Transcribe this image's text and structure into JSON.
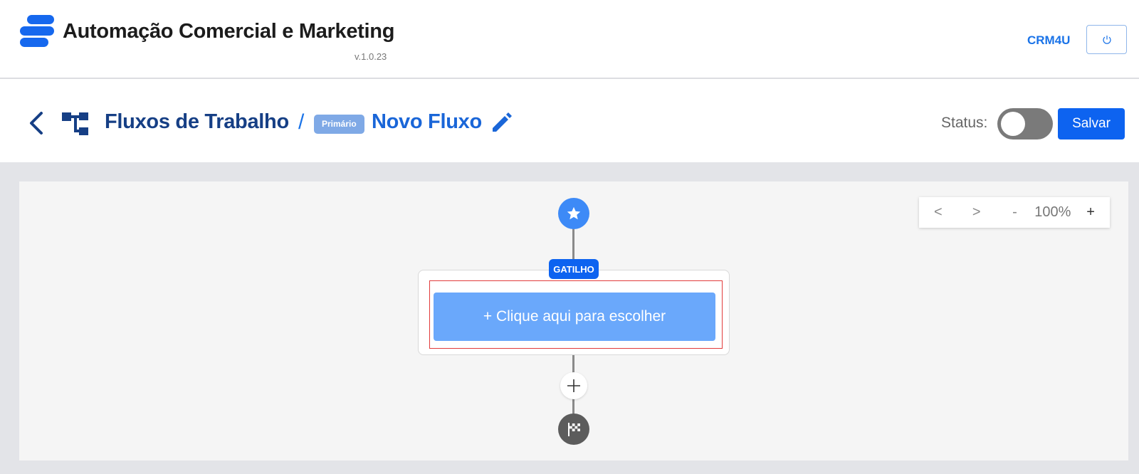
{
  "header": {
    "app_title": "Automação Comercial e Marketing",
    "version": "v.1.0.23",
    "brand_link": "CRM4U",
    "logo_icon": "stacked-bars-logo-icon",
    "power_icon": "power-icon",
    "accent_color": "#1a73e8"
  },
  "subheader": {
    "back_icon": "chevron-left-icon",
    "section_icon": "workflow-tree-icon",
    "section_title": "Fluxos de Trabalho",
    "separator": "/",
    "badge": "Primário",
    "flow_name": "Novo Fluxo",
    "edit_icon": "pencil-icon",
    "status_label": "Status:",
    "status_on": false,
    "save_label": "Salvar"
  },
  "canvas": {
    "zoom": {
      "prev": "<",
      "next": ">",
      "minus": "-",
      "level": "100%",
      "plus": "+"
    },
    "start_icon": "star-icon",
    "trigger_tag": "GATILHO",
    "trigger_button": "+ Clique aqui para escolher",
    "add_icon": "plus-icon",
    "end_icon": "checkered-flag-icon"
  }
}
